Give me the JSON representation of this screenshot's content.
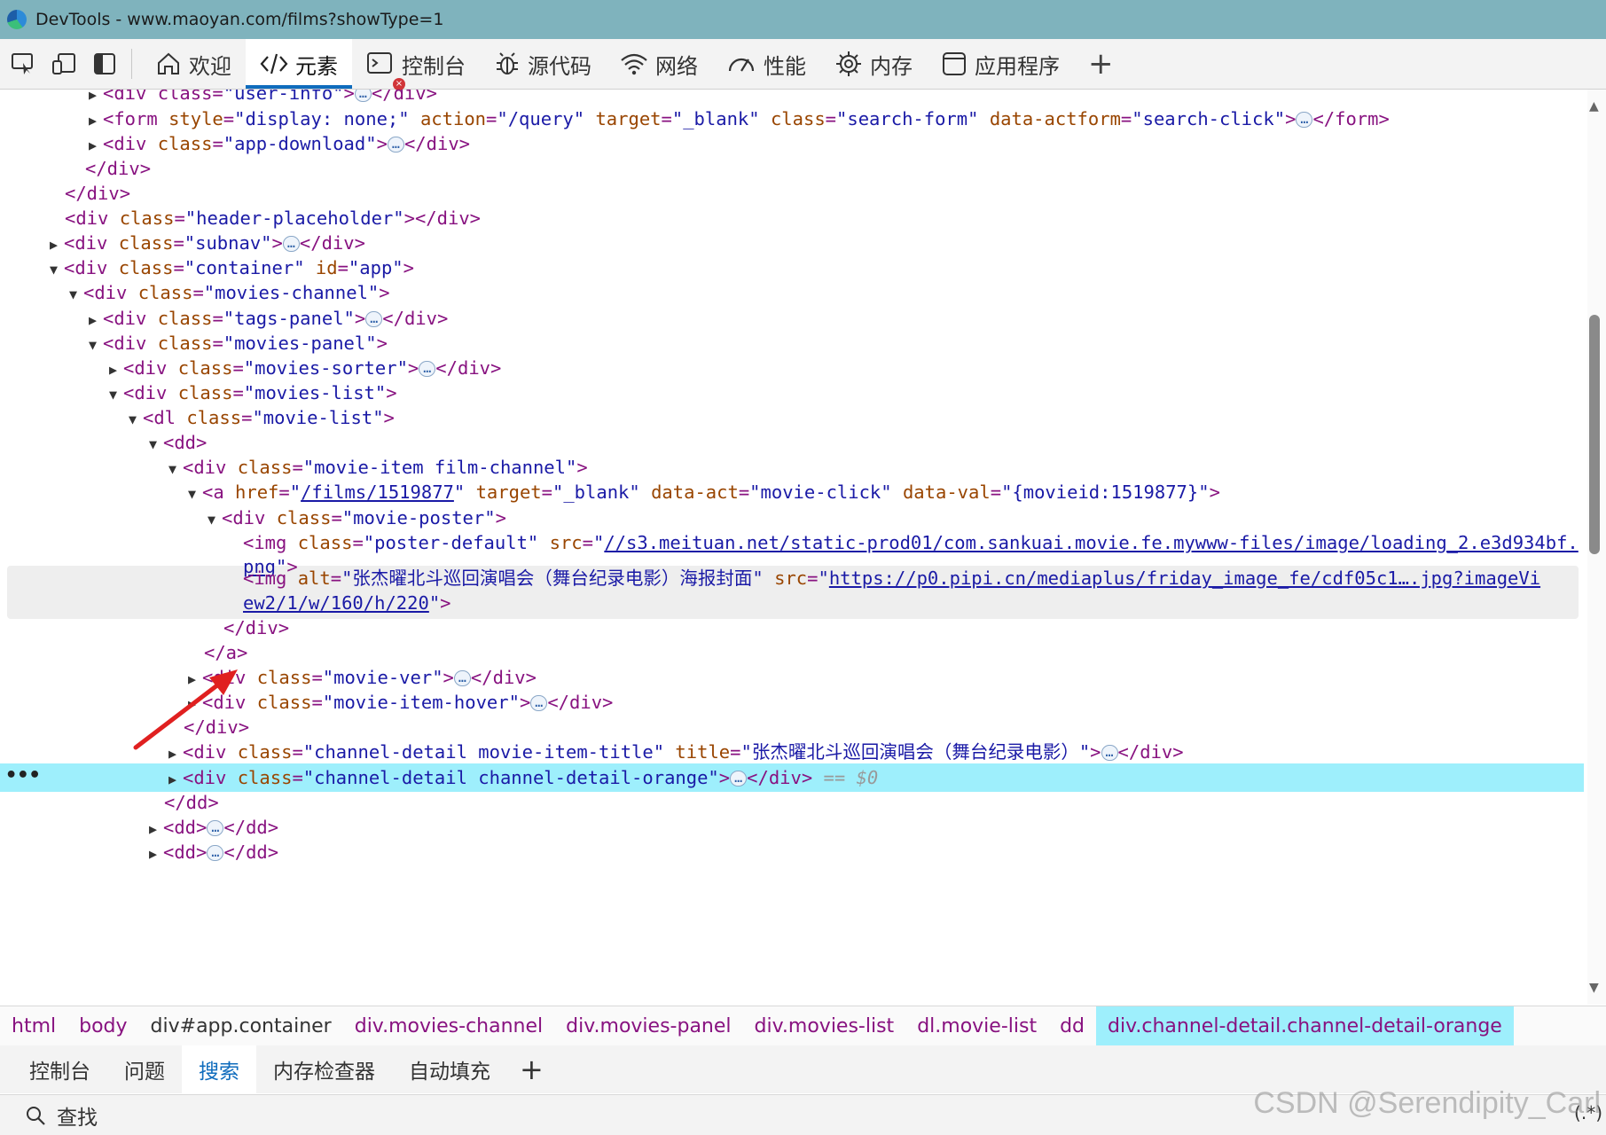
{
  "window": {
    "title": "DevTools - www.maoyan.com/films?showType=1"
  },
  "toolbar": {
    "tabs": [
      {
        "label": "欢迎",
        "icon": "home-icon"
      },
      {
        "label": "元素",
        "icon": "code-icon"
      },
      {
        "label": "控制台",
        "icon": "console-icon"
      },
      {
        "label": "源代码",
        "icon": "bug-icon"
      },
      {
        "label": "网络",
        "icon": "wifi-icon"
      },
      {
        "label": "性能",
        "icon": "performance-icon"
      },
      {
        "label": "内存",
        "icon": "memory-icon"
      },
      {
        "label": "应用程序",
        "icon": "application-icon"
      }
    ],
    "add": "+",
    "active_tab": "元素",
    "console_error_badge": "×"
  },
  "tree": {
    "l0": {
      "t1": "<div class=",
      "v1": "\"user-info\"",
      "t2": ">",
      "t3": "</div>"
    },
    "l1": {
      "tag": "<form ",
      "a1": "style",
      "v1": "\"display: none;\"",
      "a2": "action",
      "v2": "\"/query\"",
      "a3": "target",
      "v3": "\"_blank\"",
      "a4": "class",
      "v4": "\"search-form\"",
      "a5": "data-actform",
      "v5": "\"search-click\"",
      "close": "</form>"
    },
    "l2": {
      "tag": "<div ",
      "a1": "class",
      "v1": "\"app-download\"",
      "close": "</div>"
    },
    "l3": {
      "text": "</div>"
    },
    "l4": {
      "text": "</div>"
    },
    "l5": {
      "tag": "<div ",
      "a1": "class",
      "v1": "\"header-placeholder\"",
      "close": "></div>"
    },
    "l6": {
      "tag": "<div ",
      "a1": "class",
      "v1": "\"subnav\"",
      "close": "</div>"
    },
    "l7": {
      "tag": "<div ",
      "a1": "class",
      "v1": "\"container\"",
      "a2": "id",
      "v2": "\"app\""
    },
    "l8": {
      "tag": "<div ",
      "a1": "class",
      "v1": "\"movies-channel\""
    },
    "l9": {
      "tag": "<div ",
      "a1": "class",
      "v1": "\"tags-panel\"",
      "close": "</div>"
    },
    "l10": {
      "tag": "<div ",
      "a1": "class",
      "v1": "\"movies-panel\""
    },
    "l11": {
      "tag": "<div ",
      "a1": "class",
      "v1": "\"movies-sorter\"",
      "close": "</div>"
    },
    "l12": {
      "tag": "<div ",
      "a1": "class",
      "v1": "\"movies-list\""
    },
    "l13": {
      "tag": "<dl ",
      "a1": "class",
      "v1": "\"movie-list\""
    },
    "l14": {
      "text": "<dd>"
    },
    "l15": {
      "tag": "<div ",
      "a1": "class",
      "v1": "\"movie-item film-channel\""
    },
    "l16": {
      "tag": "<a ",
      "a1": "href",
      "v1a": "\"",
      "link": "/films/1519877",
      "v1b": "\"",
      "a2": "target",
      "v2": "\"_blank\"",
      "a3": "data-act",
      "v3": "\"movie-click\"",
      "a4": "data-val",
      "v4": "\"{movieid:1519877}\""
    },
    "l17": {
      "tag": "<div ",
      "a1": "class",
      "v1": "\"movie-poster\""
    },
    "l18": {
      "tag": "<img ",
      "a1": "class",
      "v1": "\"poster-default\"",
      "a2": "src",
      "q": "\"",
      "link": "//s3.meituan.net/static-prod01/com.sankuai.movie.fe.mywww-files/image/loading_2.e3d934bf."
    },
    "l19": {
      "link": "png",
      "q": "\"",
      "end": ">"
    },
    "l20": {
      "tag": "<img ",
      "a1": "alt",
      "v1": "\"张杰曜北斗巡回演唱会（舞台纪录电影）海报封面\"",
      "a2": "src",
      "q": "\"",
      "link": "https://p0.pipi.cn/mediaplus/friday_image_fe/cdf05c1….jpg?imageVi"
    },
    "l21": {
      "link": "ew2/1/w/160/h/220",
      "q": "\"",
      "end": ">"
    },
    "l22": {
      "text": "</div>"
    },
    "l23": {
      "text": "</a>"
    },
    "l24": {
      "tag": "<div ",
      "a1": "class",
      "v1": "\"movie-ver\"",
      "close": "</div>"
    },
    "l25": {
      "tag": "<div ",
      "a1": "class",
      "v1": "\"movie-item-hover\"",
      "close": "</div>"
    },
    "l26": {
      "text": "</div>"
    },
    "l27": {
      "tag": "<div ",
      "a1": "class",
      "v1": "\"channel-detail movie-item-title\"",
      "a2": "title",
      "v2": "\"张杰曜北斗巡回演唱会（舞台纪录电影）\"",
      "close": "</div>"
    },
    "l28": {
      "tag": "<div ",
      "a1": "class",
      "v1": "\"channel-detail channel-detail-orange\"",
      "close": "</div>",
      "eq": " == ",
      "dollar": "$0"
    },
    "l29": {
      "text": "</dd>"
    },
    "l30": {
      "open": "<dd>",
      "close": "</dd>"
    },
    "l31": {
      "open": "<dd>",
      "close": "</dd>"
    },
    "ellipsis": "…",
    "left_dots": "•••"
  },
  "breadcrumb": {
    "items": [
      "html",
      "body",
      "div#app.container",
      "div.movies-channel",
      "div.movies-panel",
      "div.movies-list",
      "dl.movie-list",
      "dd",
      "div.channel-detail.channel-detail-orange"
    ]
  },
  "drawer": {
    "tabs": [
      "控制台",
      "问题",
      "搜索",
      "内存检查器",
      "自动填充"
    ],
    "active_tab": "搜索",
    "add": "+"
  },
  "search": {
    "placeholder": "查找",
    "regex_toggle": "(.*)"
  },
  "watermark": "CSDN @Serendipity_Carl",
  "colors": {
    "titlebar": "#7fb3bd",
    "selected_row": "#9eeffc",
    "active_tab_underline": "#0f6cbd",
    "annotation_arrow": "#e02020"
  }
}
